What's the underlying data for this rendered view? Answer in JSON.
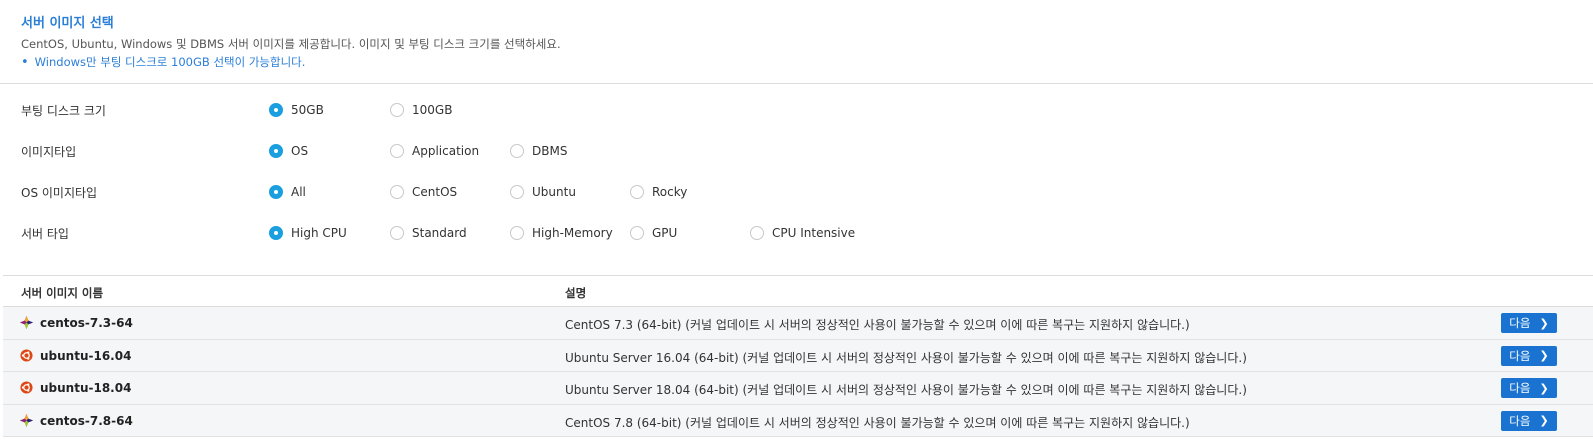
{
  "header": {
    "title": "서버 이미지 선택",
    "description": "CentOS, Ubuntu, Windows 및 DBMS 서버 이미지를 제공합니다. 이미지 및 부팅 디스크 크기를 선택하세요.",
    "note": "Windows만 부팅 디스크로 100GB 선택이 가능합니다."
  },
  "filters": {
    "boot_disk": {
      "label": "부팅 디스크 크기",
      "options": [
        "50GB",
        "100GB"
      ],
      "selected": "50GB"
    },
    "image_type": {
      "label": "이미지타입",
      "options": [
        "OS",
        "Application",
        "DBMS"
      ],
      "selected": "OS"
    },
    "os_image_type": {
      "label": "OS 이미지타입",
      "options": [
        "All",
        "CentOS",
        "Ubuntu",
        "Rocky"
      ],
      "selected": "All"
    },
    "server_type": {
      "label": "서버 타입",
      "options": [
        "High CPU",
        "Standard",
        "High-Memory",
        "GPU",
        "CPU Intensive"
      ],
      "selected": "High CPU"
    }
  },
  "table": {
    "headers": [
      "서버 이미지 이름",
      "설명"
    ],
    "next_label": "다음",
    "rows": [
      {
        "os": "centos",
        "icon": "centos-icon",
        "name": "centos-7.3-64",
        "desc": "CentOS 7.3 (64-bit) (커널 업데이트 시 서버의 정상적인 사용이 불가능할 수 있으며 이에 따른 복구는 지원하지 않습니다.)"
      },
      {
        "os": "ubuntu",
        "icon": "ubuntu-icon",
        "name": "ubuntu-16.04",
        "desc": "Ubuntu Server 16.04 (64-bit) (커널 업데이트 시 서버의 정상적인 사용이 불가능할 수 있으며 이에 따른 복구는 지원하지 않습니다.)"
      },
      {
        "os": "ubuntu",
        "icon": "ubuntu-icon",
        "name": "ubuntu-18.04",
        "desc": "Ubuntu Server 18.04 (64-bit) (커널 업데이트 시 서버의 정상적인 사용이 불가능할 수 있으며 이에 따른 복구는 지원하지 않습니다.)"
      },
      {
        "os": "centos",
        "icon": "centos-icon",
        "name": "centos-7.8-64",
        "desc": "CentOS 7.8 (64-bit) (커널 업데이트 시 서버의 정상적인 사용이 불가능할 수 있으며 이에 따른 복구는 지원하지 않습니다.)"
      }
    ]
  },
  "colors": {
    "accent": "#2b7fd8",
    "radio": "#1a9fe0",
    "button": "#1a73d1",
    "row_bg": "#f5f6f7"
  }
}
